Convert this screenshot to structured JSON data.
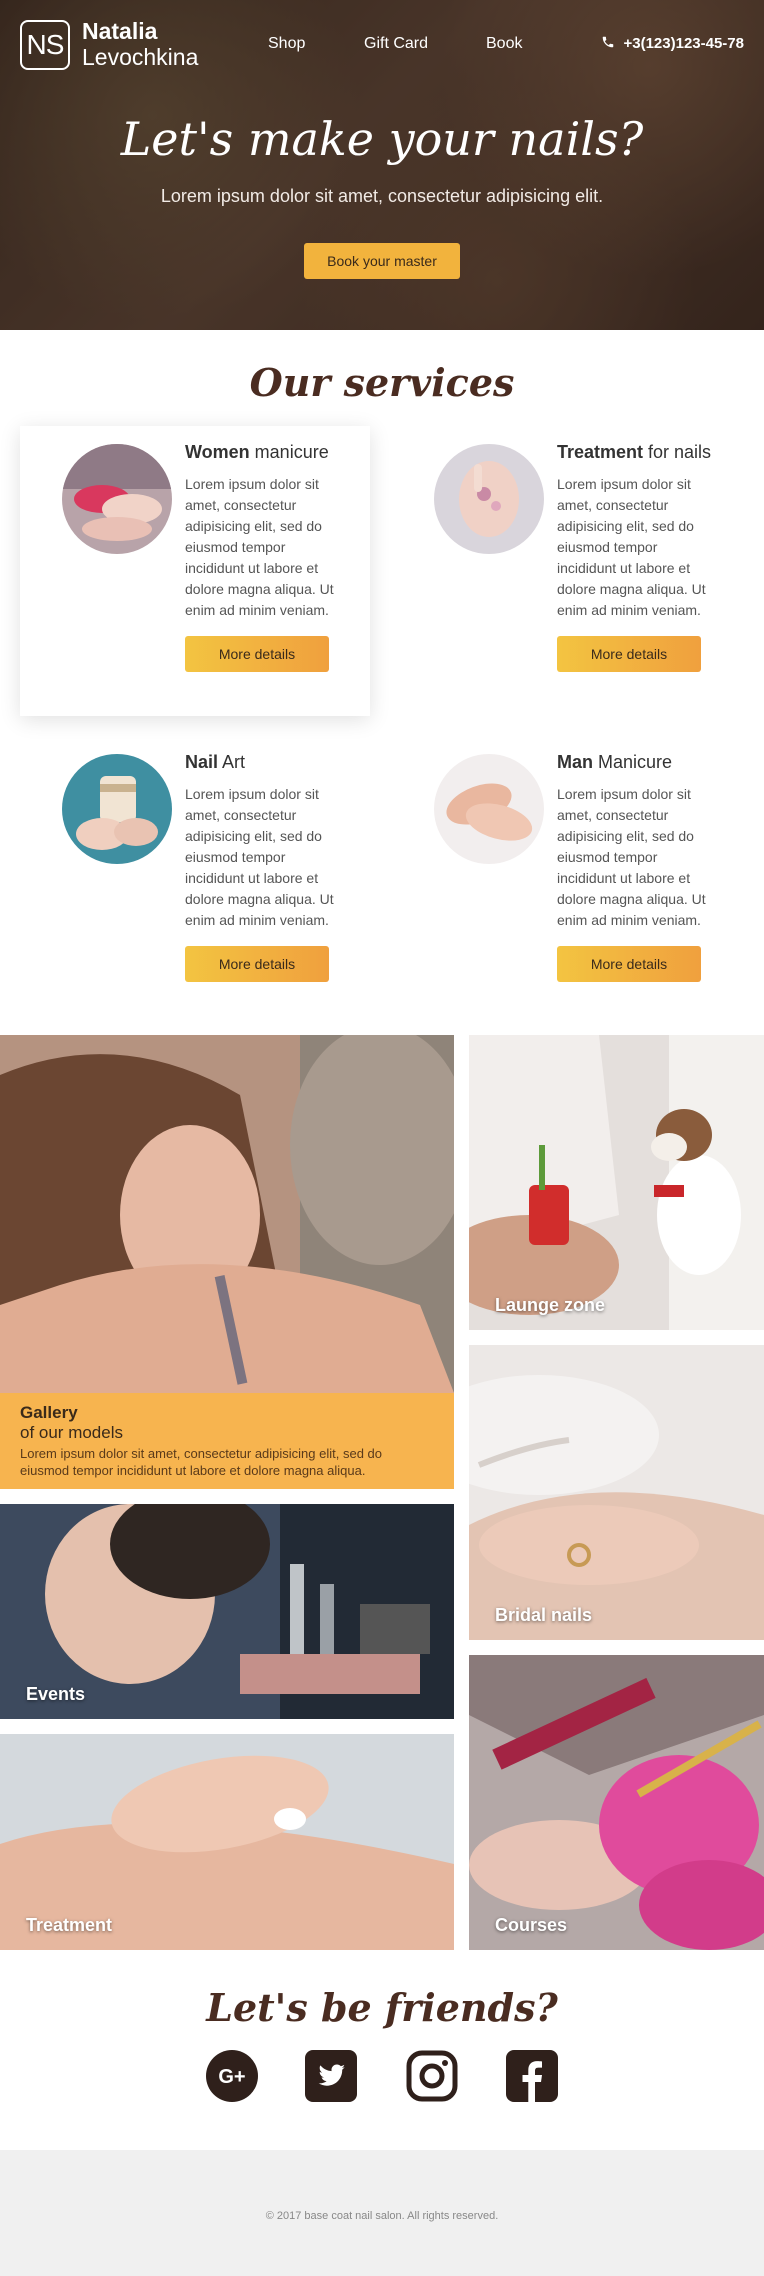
{
  "header": {
    "logo_mark": "NS",
    "logo_first": "Natalia",
    "logo_last": "Levochkina",
    "nav": [
      "Shop",
      "Gift Card",
      "Book"
    ],
    "phone": "+3(123)123-45-78"
  },
  "hero": {
    "title": "Let's make your nails?",
    "subtitle": "Lorem ipsum dolor sit amet, consectetur adipisicing elit.",
    "button": "Book your master"
  },
  "services": {
    "title": "Our services",
    "items": [
      {
        "bold": "Women",
        "rest": " manicure",
        "text": "Lorem ipsum dolor sit amet, consectetur adipisicing elit, sed do eiusmod tempor incididunt ut labore et dolore magna aliqua. Ut enim ad minim veniam.",
        "button": "More details"
      },
      {
        "bold": "Treatment",
        "rest": " for nails",
        "text": "Lorem ipsum dolor sit amet, consectetur adipisicing elit, sed do eiusmod tempor incididunt ut labore et dolore magna aliqua. Ut enim ad minim veniam.",
        "button": "More details"
      },
      {
        "bold": "Nail",
        "rest": " Art",
        "text": "Lorem ipsum dolor sit amet, consectetur adipisicing elit, sed do eiusmod tempor incididunt ut labore et dolore magna aliqua. Ut enim ad minim veniam.",
        "button": "More details"
      },
      {
        "bold": "Man",
        "rest": " Manicure",
        "text": "Lorem ipsum dolor sit amet, consectetur adipisicing elit, sed do eiusmod tempor incididunt ut labore et dolore magna aliqua. Ut enim ad minim veniam.",
        "button": "More details"
      }
    ]
  },
  "gallery": {
    "info_title": "Gallery",
    "info_sub": "of our models",
    "info_text": "Lorem ipsum dolor sit amet, consectetur adipisicing elit, sed do eiusmod tempor incididunt ut labore et dolore magna aliqua.",
    "tiles": [
      "Launge zone",
      "Bridal nails",
      "Events",
      "Treatment",
      "Courses"
    ]
  },
  "friends": {
    "title": "Let's be friends?",
    "icons": [
      "google-plus-icon",
      "twitter-icon",
      "instagram-icon",
      "facebook-icon"
    ]
  },
  "footer": {
    "copyright": "© 2017 base coat nail salon. All rights reserved."
  },
  "colors": {
    "accent": "#f2b33d",
    "accent_gradient_end": "#f0a03e",
    "gallery_banner": "#f7b44f",
    "heading": "#4a2c21",
    "footer_bg": "#f0f0f0"
  }
}
